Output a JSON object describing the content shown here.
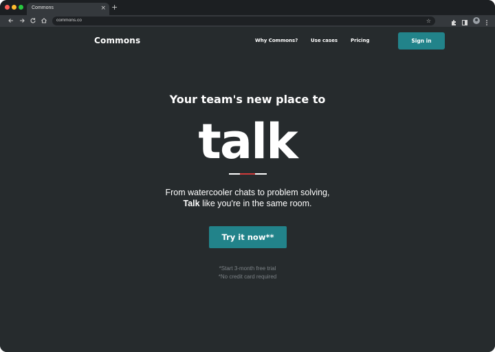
{
  "browser": {
    "tab_title": "Commons",
    "tab_close": "×",
    "new_tab": "+",
    "url": "commons.co",
    "icons": [
      "back-icon",
      "forward-icon",
      "reload-icon",
      "home-icon",
      "star-icon",
      "extensions-icon",
      "sidebar-icon",
      "profile-avatar",
      "more-menu-icon"
    ]
  },
  "header": {
    "logo": "Commons",
    "nav": [
      "Why Commons?",
      "Use cases",
      "Pricing"
    ],
    "signin": "Sign in"
  },
  "hero": {
    "headline": "Your team's new place to",
    "word": "talk",
    "line1": "From watercooler chats to problem solving,",
    "line2_bold": "Talk",
    "line2_rest": " like you're in the same room.",
    "cta": "Try it now**",
    "note1": "*Start 3-month free trial",
    "note2": "*No credit card required"
  },
  "colors": {
    "background": "#262b2d",
    "accent": "#22838a",
    "underline_accent": "#d13b3b"
  }
}
